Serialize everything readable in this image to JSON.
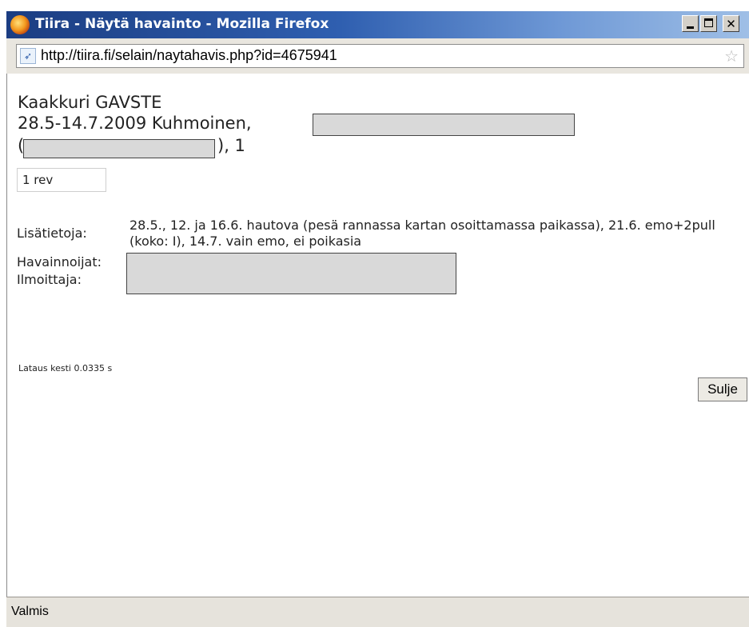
{
  "window": {
    "title": "Tiira - Näytä havainto - Mozilla Firefox",
    "url": "http://tiira.fi/selain/naytahavis.php?id=4675941"
  },
  "observation": {
    "species": "Kaakkuri GAVSTE",
    "date_place": "28.5-14.7.2009 Kuhmoinen,",
    "line3_open": "(",
    "line3_close": "), 1",
    "count": "1 rev",
    "info_label": "Lisätietoja:",
    "info_text": "28.5., 12. ja 16.6. hautova (pesä rannassa kartan osoittamassa paikassa), 21.6. emo+2pull (koko: I), 14.7. vain emo, ei poikasia",
    "observers_label": "Havainnoijat:",
    "reporter_label": "Ilmoittaja:"
  },
  "footer": {
    "load_time": "Lataus kesti 0.0335 s",
    "close_label": "Sulje"
  },
  "status": {
    "text": "Valmis"
  },
  "colors": {
    "titlebar_start": "#1b3d82",
    "titlebar_end": "#9fbfe6",
    "redaction_fill": "#d9d9d9"
  },
  "icons": {
    "app": "firefox-icon",
    "site": "tiira-bird-icon",
    "bookmark": "star-icon"
  }
}
